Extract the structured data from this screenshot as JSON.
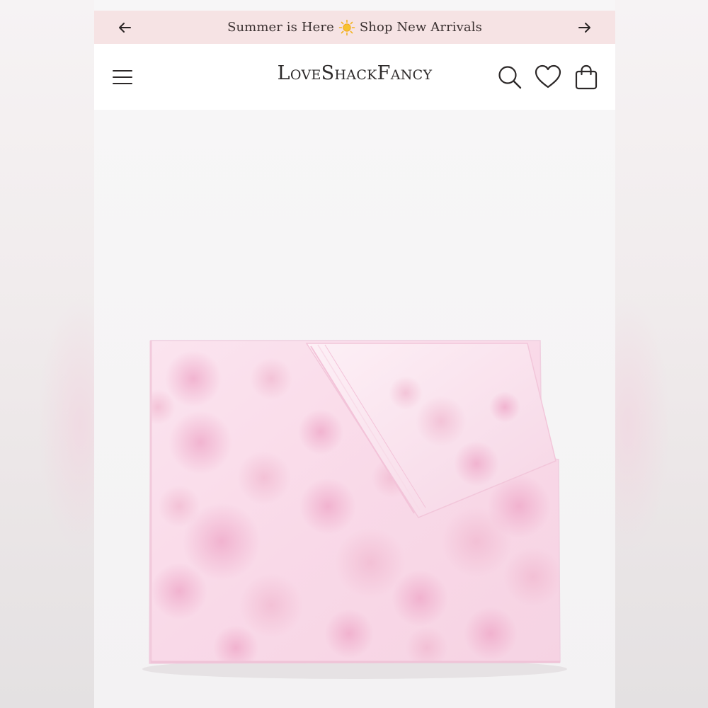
{
  "promo": {
    "text_before": "Summer is Here",
    "text_after": "Shop New Arrivals",
    "emoji_icon": "sun-icon",
    "background": "#f6e3e4"
  },
  "header": {
    "logo_text": "LoveShackFancy",
    "icons": [
      "menu-icon",
      "search-icon",
      "heart-icon",
      "shopping-bag-icon"
    ]
  },
  "product": {
    "image": "pink-floral-folded-sheet",
    "accent": "#f1b9d0"
  }
}
